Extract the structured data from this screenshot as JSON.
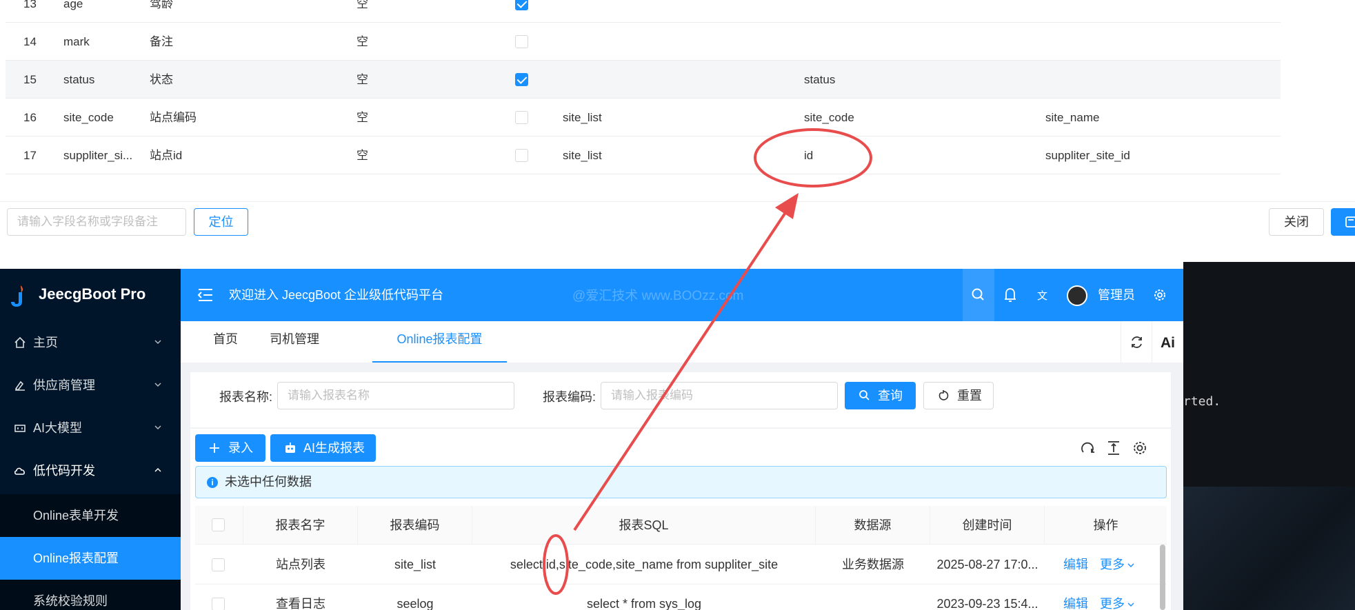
{
  "field_table": {
    "rows": [
      {
        "num": "13",
        "name": "age",
        "desc": "驾龄",
        "default": "空",
        "checked": true,
        "dict_table": "",
        "dict_code": "",
        "dict_text": ""
      },
      {
        "num": "14",
        "name": "mark",
        "desc": "备注",
        "default": "空",
        "checked": false,
        "dict_table": "",
        "dict_code": "",
        "dict_text": ""
      },
      {
        "num": "15",
        "name": "status",
        "desc": "状态",
        "default": "空",
        "checked": true,
        "dict_table": "",
        "dict_code": "status",
        "dict_text": ""
      },
      {
        "num": "16",
        "name": "site_code",
        "desc": "站点编码",
        "default": "空",
        "checked": false,
        "dict_table": "site_list",
        "dict_code": "site_code",
        "dict_text": "site_name"
      },
      {
        "num": "17",
        "name": "suppliter_si...",
        "desc": "站点id",
        "default": "空",
        "checked": false,
        "dict_table": "site_list",
        "dict_code": "id",
        "dict_text": "suppliter_site_id"
      }
    ]
  },
  "modal_footer": {
    "locate_placeholder": "请输入字段名称或字段备注",
    "locate_button": "定位",
    "close_button": "关闭"
  },
  "terminal": {
    "text": "rted."
  },
  "app": {
    "logo_text": "JeecgBoot Pro",
    "menu": [
      {
        "label": "主页",
        "icon": "home-icon"
      },
      {
        "label": "供应商管理",
        "icon": "supplier-icon"
      },
      {
        "label": "AI大模型",
        "icon": "ai-model-icon"
      },
      {
        "label": "低代码开发",
        "icon": "cloud-icon"
      }
    ],
    "submenu": [
      {
        "label": "Online表单开发"
      },
      {
        "label": "Online报表配置"
      },
      {
        "label": "系统校验规则"
      }
    ],
    "header": {
      "welcome": "欢迎进入 JeecgBoot 企业级低代码平台",
      "watermark": "@爱汇技术 www.BOOzz.com",
      "username": "管理员"
    },
    "tabs": [
      {
        "label": "首页"
      },
      {
        "label": "司机管理"
      },
      {
        "label": "Online报表配置"
      }
    ],
    "search": {
      "name_label": "报表名称:",
      "name_placeholder": "请输入报表名称",
      "code_label": "报表编码:",
      "code_placeholder": "请输入报表编码",
      "query_button": "查询",
      "reset_button": "重置"
    },
    "toolbar": {
      "add_button": "录入",
      "ai_button": "AI生成报表"
    },
    "alert_text": "未选中任何数据",
    "columns": [
      "报表名字",
      "报表编码",
      "报表SQL",
      "数据源",
      "创建时间",
      "操作"
    ],
    "rows": [
      {
        "name": "站点列表",
        "code": "site_list",
        "sql": "select id,site_code,site_name from suppliter_site",
        "source": "业务数据源",
        "created": "2025-08-27 17:0...",
        "edit": "编辑",
        "more": "更多"
      },
      {
        "name": "查看日志",
        "code": "seelog",
        "sql": "select * from sys_log",
        "source": "",
        "created": "2023-09-23 15:4...",
        "edit": "编辑",
        "more": "更多"
      }
    ]
  },
  "colors": {
    "primary": "#1890ff",
    "sidebar": "#001529",
    "annotation": "#e84c4c"
  }
}
